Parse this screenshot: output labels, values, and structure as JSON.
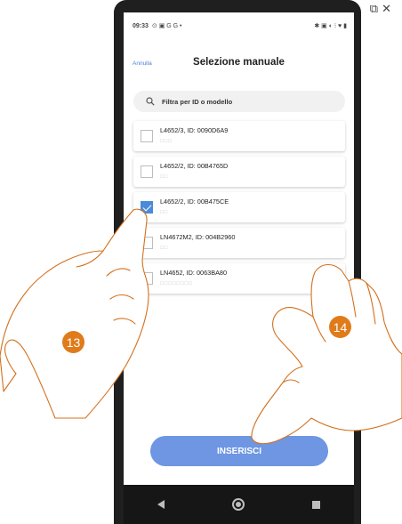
{
  "status": {
    "time": "09:33",
    "left_icons": "⊙ ▣ G G •",
    "right_icons": "✱ ▣ ◐ ⁝ ♥ ▮"
  },
  "header": {
    "cancel_label": "Annulla",
    "title": "Selezione manuale"
  },
  "search": {
    "placeholder": "Filtra per ID o modello",
    "icon": "search-icon"
  },
  "devices": [
    {
      "label": "L4652/3, ID: 0090D6A9",
      "sub": "□□□",
      "checked": false
    },
    {
      "label": "L4652/2, ID: 00B4765D",
      "sub": "□□",
      "checked": false
    },
    {
      "label": "L4652/2, ID: 00B475CE",
      "sub": "□□",
      "checked": true
    },
    {
      "label": "LN4672M2, ID: 004B2960",
      "sub": "□□",
      "checked": false
    },
    {
      "label": "LN4652, ID: 0063BA80",
      "sub": "□□□□□□□□",
      "checked": false
    }
  ],
  "insert_button": "INSERISCI",
  "steps": {
    "left": "13",
    "right": "14"
  },
  "colors": {
    "accent": "#4a8ad9",
    "button": "#6e96e2",
    "step_badge": "#e07b1a"
  }
}
